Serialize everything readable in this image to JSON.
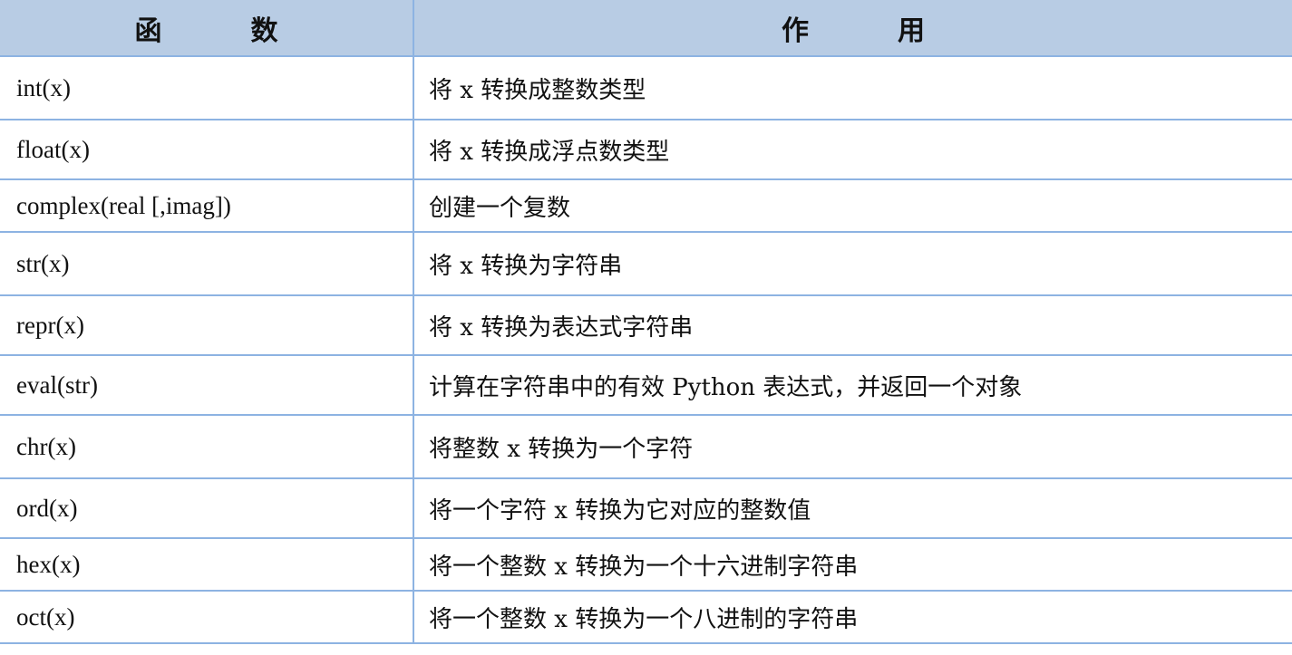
{
  "table": {
    "headers": [
      "函　数",
      "作　用"
    ],
    "rows": [
      {
        "func": "int(x)",
        "desc": "将 x  转换成整数类型"
      },
      {
        "func": "float(x)",
        "desc": "将 x  转换成浮点数类型"
      },
      {
        "func": "complex(real [,imag])",
        "desc": "创建一个复数"
      },
      {
        "func": "str(x)",
        "desc": "将 x  转换为字符串"
      },
      {
        "func": "repr(x)",
        "desc": "将 x  转换为表达式字符串"
      },
      {
        "func": "eval(str)",
        "desc": "计算在字符串中的有效 Python  表达式，并返回一个对象"
      },
      {
        "func": "chr(x)",
        "desc": "将整数 x  转换为一个字符"
      },
      {
        "func": "ord(x)",
        "desc": "将一个字符 x  转换为它对应的整数值"
      },
      {
        "func": "hex(x)",
        "desc": "将一个整数 x  转换为一个十六进制字符串"
      },
      {
        "func": "oct(x)",
        "desc": "将一个整数 x  转换为一个八进制的字符串"
      }
    ]
  }
}
